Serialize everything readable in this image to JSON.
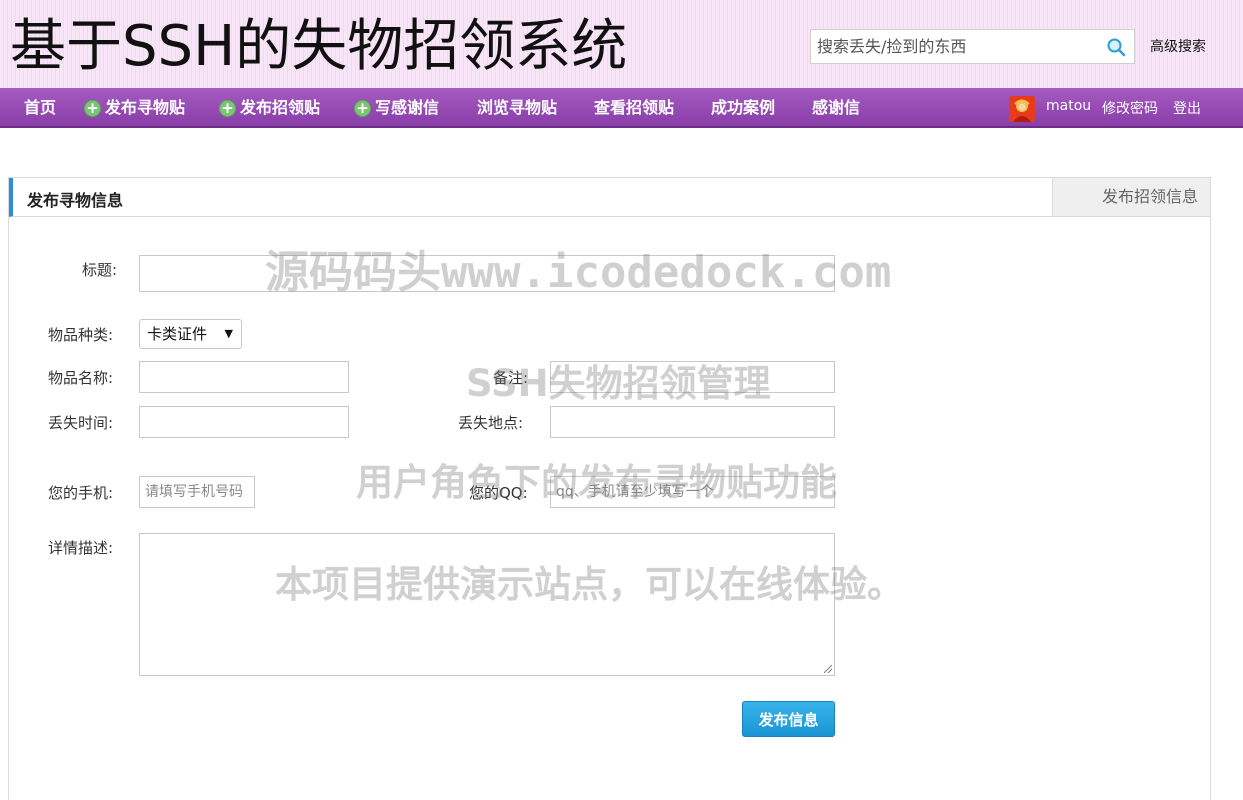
{
  "header": {
    "site_title": "基于SSH的失物招领系统",
    "search_placeholder": "搜索丢失/捡到的东西",
    "advanced_search": "高级搜索"
  },
  "nav": {
    "home": "首页",
    "post_lost": "发布寻物贴",
    "post_found": "发布招领贴",
    "write_thanks": "写感谢信",
    "browse_lost": "浏览寻物贴",
    "view_found": "查看招领贴",
    "success_cases": "成功案例",
    "thanks_letters": "感谢信",
    "username": "matou",
    "change_password": "修改密码",
    "logout": "登出"
  },
  "panel": {
    "title": "发布寻物信息",
    "alt_tab": "发布招领信息"
  },
  "form": {
    "title_label": "标题:",
    "category_label": "物品种类:",
    "category_value": "卡类证件",
    "item_name_label": "物品名称:",
    "remark_label": "备注:",
    "lost_time_label": "丢失时间:",
    "lost_place_label": "丢失地点:",
    "phone_label": "您的手机:",
    "phone_placeholder": "请填写手机号码",
    "qq_label": "您的QQ:",
    "qq_placeholder": "qq、手机请至少填写一个",
    "detail_label": "详情描述:",
    "submit": "发布信息"
  },
  "watermarks": {
    "line1": "源码码头www.icodedock.com",
    "line2": "SSH失物招领管理",
    "line3": "用户角色下的发布寻物贴功能",
    "line4": "本项目提供演示站点，可以在线体验。"
  }
}
